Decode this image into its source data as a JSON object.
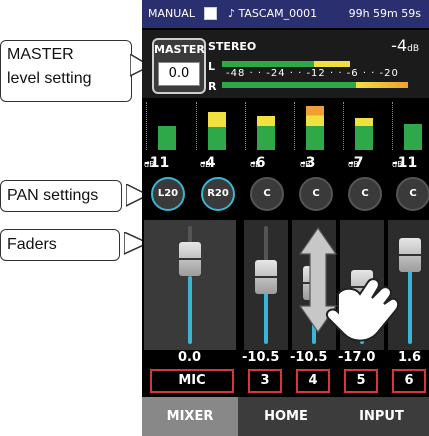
{
  "statusbar": {
    "mode": "MANUAL",
    "file": "♪ TASCAM_0001",
    "time": "99h 59m 59s"
  },
  "master": {
    "label": "MASTER",
    "value": "0.0",
    "stereo": "STEREO",
    "db": "-4",
    "unit": "dB",
    "L": "L",
    "R": "R",
    "scale": "-48 · · -24 · · -12 · · -6 · · -20"
  },
  "channels": [
    {
      "db": "-11",
      "pan": "L20",
      "value": "0.0",
      "label": "MIC"
    },
    {
      "db": "-4",
      "pan": "R20",
      "value": "-10.5",
      "label": "3"
    },
    {
      "db": "-6",
      "pan": "C",
      "value": "-10.5",
      "label": "4"
    },
    {
      "db": "-3",
      "pan": "C",
      "value": "-17.0",
      "label": "5"
    },
    {
      "db": "-7",
      "pan": "C",
      "value": "1.6",
      "label": "6"
    },
    {
      "db": "-11",
      "pan": "C"
    }
  ],
  "tabs": {
    "mixer": "MIXER",
    "home": "HOME",
    "input": "INPUT"
  },
  "callouts": {
    "master_line1": "MASTER",
    "master_line2": "level setting",
    "pan": "PAN settings",
    "faders": "Faders"
  },
  "colors": {
    "accent": "#3cb4d4",
    "status_bg": "#2a2f6f",
    "channel_border": "#d23a3a"
  }
}
